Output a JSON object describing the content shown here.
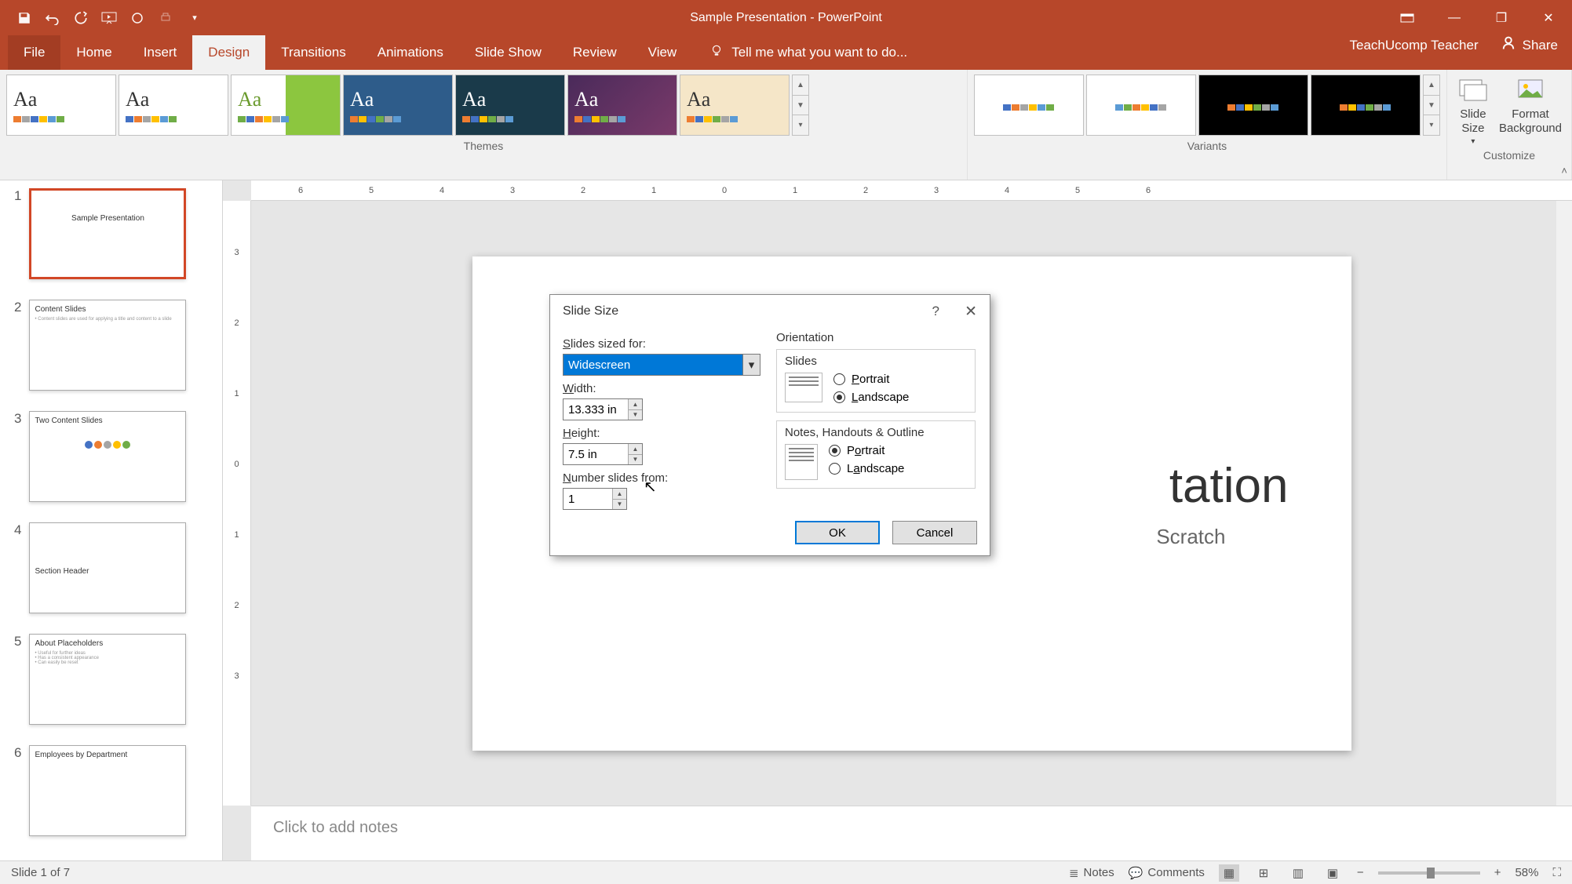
{
  "app": {
    "title": "Sample Presentation - PowerPoint"
  },
  "qat": {
    "save": "💾",
    "undo": "↶",
    "redo": "↻",
    "start": "▷",
    "more": "⋯"
  },
  "win": {
    "opts": "▭",
    "min": "—",
    "max": "❐",
    "close": "✕"
  },
  "tabs": {
    "file": "File",
    "home": "Home",
    "insert": "Insert",
    "design": "Design",
    "transitions": "Transitions",
    "animations": "Animations",
    "slideshow": "Slide Show",
    "review": "Review",
    "view": "View",
    "tellme": "Tell me what you want to do...",
    "user": "TeachUcomp Teacher",
    "share": "Share"
  },
  "ribbon": {
    "themes_label": "Themes",
    "variants_label": "Variants",
    "customize_label": "Customize",
    "slide_size": "Slide\nSize",
    "format_bg": "Format\nBackground",
    "aa": "Aa"
  },
  "slides": {
    "s1_num": "1",
    "s1_title": "Sample Presentation",
    "s2_num": "2",
    "s2_title": "Content Slides",
    "s3_num": "3",
    "s3_title": "Two Content Slides",
    "s4_num": "4",
    "s4_title": "Section Header",
    "s5_num": "5",
    "s5_title": "About Placeholders",
    "s6_num": "6",
    "s6_title": "Employees by Department"
  },
  "canvas": {
    "title": "tation",
    "subtitle": "Scratch"
  },
  "notes": {
    "placeholder": "Click to add notes"
  },
  "ruler": {
    "h": [
      "6",
      "5",
      "4",
      "3",
      "2",
      "1",
      "0",
      "1",
      "2",
      "3",
      "4",
      "5",
      "6"
    ],
    "v": [
      "3",
      "2",
      "1",
      "0",
      "1",
      "2",
      "3"
    ]
  },
  "status": {
    "slide_info": "Slide 1 of 7",
    "notes": "Notes",
    "comments": "Comments",
    "zoom": "58%"
  },
  "dialog": {
    "title": "Slide Size",
    "sized_for_label": "Slides sized for:",
    "sized_for_value": "Widescreen",
    "width_label": "Width:",
    "width_value": "13.333 in",
    "height_label": "Height:",
    "height_value": "7.5 in",
    "number_label": "Number slides from:",
    "number_value": "1",
    "orientation_label": "Orientation",
    "slides_label": "Slides",
    "notes_label": "Notes, Handouts & Outline",
    "portrait": "Portrait",
    "landscape": "Landscape",
    "ok": "OK",
    "cancel": "Cancel"
  }
}
